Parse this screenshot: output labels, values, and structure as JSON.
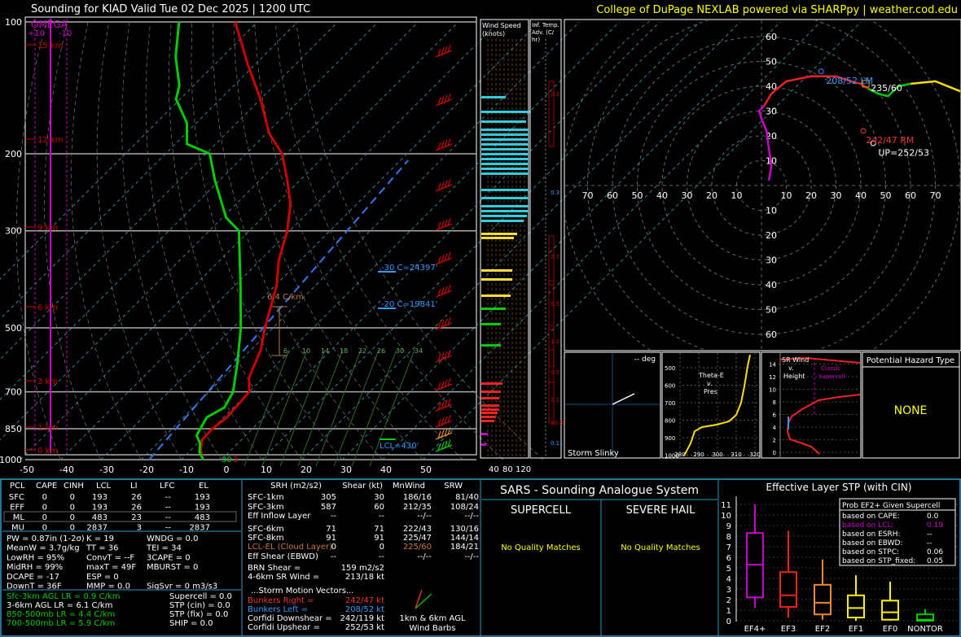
{
  "title": "Sounding for KIAD Valid  Tue 02 Dec 2025 | 1200 UTC",
  "credit": "College of DuPage NEXLAB powered via SHARPpy | weather.cod.edu",
  "colors": {
    "bg": "#000000",
    "grid": "#ffffff",
    "temp": "#cc0000",
    "dew": "#00cc00",
    "omega": "#cc00cc",
    "panel_border": "#3399cc",
    "credit": "#ffff00"
  },
  "skewt": {
    "omega_label": "OMEGA",
    "omega_ticks": [
      "+10",
      "-10"
    ],
    "pressure_labels": [
      "100",
      "200",
      "300",
      "500",
      "700",
      "850",
      "1000"
    ],
    "temp_ticks": [
      "-50",
      "-40",
      "-30",
      "-20",
      "-10",
      "0",
      "10",
      "20",
      "30",
      "40",
      "50"
    ],
    "height_labels": [
      "15 km",
      "12 km",
      "9 km",
      "6 km",
      "3 km",
      "1 km",
      "0 km"
    ],
    "lapse_label": "6.4 C/km",
    "level_labels": [
      "-30 C=24397'",
      "-20 C=19841'",
      "LCL=430'"
    ],
    "mixing_ratio_labels": [
      "6",
      "10",
      "14",
      "18",
      "22",
      "26",
      "30",
      "34"
    ],
    "sfc_temps": [
      "30",
      "3"
    ]
  },
  "wind_speed": {
    "title": "Wind Speed (knots)",
    "ticks": [
      "40",
      "80",
      "120"
    ]
  },
  "inf_temp": {
    "title": "Inf. Temp. Adv. (C/hr)",
    "values": [
      "2.2",
      "0.3",
      "2.7",
      "0.5",
      "1.2",
      "0.5",
      "2.1",
      "10.8",
      "0.11"
    ]
  },
  "hodograph": {
    "ring_labels": [
      "10",
      "20",
      "30",
      "40",
      "50",
      "60",
      "70"
    ],
    "left_motion_label": "208/52 LM",
    "right_motion_label": "242/47 RM",
    "upshear_label": "UP=252/53",
    "mean_wind_label": "235/60"
  },
  "storm_slinky": {
    "title": "Storm Slinky",
    "deg_label": "-- deg"
  },
  "theta_e": {
    "title": "Theta-E v. Pres",
    "y_ticks": [
      "500",
      "600",
      "700",
      "800",
      "900",
      "1000"
    ],
    "x_ticks": [
      "280",
      "290",
      "300",
      "310",
      "320"
    ]
  },
  "sr_wind": {
    "title": "SR Wind v. Height",
    "classic_label": "Classic Supercell",
    "y_ticks": [
      "0",
      "2",
      "4",
      "6",
      "8",
      "10",
      "12",
      "14"
    ]
  },
  "hazard": {
    "title": "Potential Hazard Type",
    "value": "NONE"
  },
  "parcels": {
    "headers": [
      "PCL",
      "CAPE",
      "CINH",
      "LCL",
      "LI",
      "LFC",
      "EL"
    ],
    "rows": [
      [
        "SFC",
        "0",
        "0",
        "193",
        "26",
        "--",
        "193"
      ],
      [
        "EFF",
        "0",
        "0",
        "193",
        "26",
        "--",
        "193"
      ],
      [
        "ML",
        "0",
        "0",
        "483",
        "23",
        "--",
        "483"
      ],
      [
        "MU",
        "0",
        "0",
        "2837",
        "3",
        "--",
        "2837"
      ]
    ]
  },
  "indices": [
    [
      "PW = 0.87in (1-2σ)",
      "K = 19",
      "WNDG = 0.0"
    ],
    [
      "MeanW = 3.7g/kg",
      "TT = 36",
      "TEI = 34"
    ],
    [
      "LowRH = 95%",
      "ConvT = --F",
      "3CAPE = 0"
    ],
    [
      "MidRH = 99%",
      "maxT = 49F",
      "MBURST = 0"
    ],
    [
      "DCAPE = -17",
      "ESP = 0",
      ""
    ],
    [
      "DownT = 36F",
      "MMP = 0.0",
      "SigSvr = 0 m3/s3"
    ]
  ],
  "lapse_rates": [
    "Sfc-3km AGL LR = 0.9 C/km",
    "3-6km AGL LR = 6.1 C/km",
    "850-500mb LR = 4.4 C/km",
    "700-500mb LR = 5.9 C/km"
  ],
  "composites": [
    "Supercell = 0.0",
    "STP (cin) = 0.0",
    "STP (fix) = 0.0",
    "SHIP = 0.0"
  ],
  "kinematics": {
    "headers": [
      "SRH (m2/s2)",
      "Shear (kt)",
      "MnWind",
      "SRW"
    ],
    "rows": [
      [
        "SFC-1km",
        "305",
        "30",
        "186/16",
        "81/40"
      ],
      [
        "SFC-3km",
        "587",
        "60",
        "212/35",
        "108/24"
      ],
      [
        "Eff Inflow Layer",
        "--",
        "--",
        "--/--",
        "--/--"
      ],
      [
        "SFC-6km",
        "71",
        "71",
        "222/43",
        "130/16"
      ],
      [
        "SFC-8km",
        "91",
        "91",
        "225/47",
        "144/14"
      ],
      [
        "LCL-EL (Cloud Layer)",
        "0",
        "0",
        "225/60",
        "184/21"
      ],
      [
        "Eff Shear (EBWD)",
        "--",
        "--",
        "--/--",
        "--/--"
      ]
    ],
    "brn_shear": [
      "BRN Shear =",
      "159 m2/s2"
    ],
    "sr_wind_46": [
      "4-6km SR Wind =",
      "213/18 kt"
    ],
    "storm_motion_title": "...Storm Motion Vectors...",
    "motions": [
      [
        "Bunkers Right =",
        "242/47 kt"
      ],
      [
        "Bunkers Left =",
        "208/52 kt"
      ],
      [
        "Corfidi Downshear =",
        "242/119 kt"
      ],
      [
        "Corfidi Upshear =",
        "252/53 kt"
      ]
    ],
    "barb_label_1": "1km & 6km AGL",
    "barb_label_2": "Wind Barbs"
  },
  "sars": {
    "title": "SARS - Sounding Analogue System",
    "supercell": "SUPERCELL",
    "hail": "SEVERE HAIL",
    "no_match": "No Quality Matches"
  },
  "stp": {
    "title": "Effective Layer STP (with CIN)",
    "prob_title": "Prob EF2+ Given Supercell",
    "probs": [
      [
        "based on CAPE:",
        "0.0"
      ],
      [
        "based on LCL:",
        "0.19"
      ],
      [
        "based on ESRH:",
        "--"
      ],
      [
        "based on EBWD:",
        "--"
      ],
      [
        "based on STPC:",
        "0.06"
      ],
      [
        "based on STP_fixed:",
        "0.05"
      ]
    ],
    "y_ticks": [
      "0",
      "1",
      "2",
      "3",
      "4",
      "5",
      "6",
      "7",
      "8",
      "9",
      "10",
      "11"
    ],
    "categories": [
      "EF4+",
      "EF3",
      "EF2",
      "EF1",
      "EF0",
      "NONTOR"
    ]
  },
  "chart_data": {
    "type": "line",
    "title": "Sounding for KIAD Valid  Tue 02 Dec 2025 | 1200 UTC",
    "xlabel": "",
    "ylabel": "",
    "xlim": [
      -50,
      50
    ],
    "ylim": [
      1000,
      100
    ],
    "series": [
      {
        "x": [
          -50,
          -41,
          -33,
          -26,
          -20,
          -15,
          -11,
          -8,
          -6,
          -3,
          0,
          2,
          3,
          5,
          4,
          3,
          1,
          0,
          1,
          3
        ],
        "y": [
          100,
          125,
          150,
          180,
          200,
          230,
          260,
          300,
          350,
          400,
          500,
          560,
          650,
          700,
          750,
          800,
          850,
          900,
          950,
          1000
        ]
      },
      {
        "x": [
          -64,
          -60,
          -55,
          -54,
          -48,
          -45,
          -38,
          -33,
          -25,
          -20,
          -12,
          -6,
          -2,
          1,
          1,
          -2,
          -2,
          -2,
          0,
          1,
          3
        ],
        "y": [
          100,
          120,
          140,
          150,
          170,
          190,
          200,
          230,
          280,
          300,
          400,
          500,
          600,
          700,
          760,
          800,
          850,
          880,
          920,
          960,
          1000
        ]
      }
    ],
    "stp_boxes": [
      {
        "category": "EF4+",
        "whisker_low": 1.2,
        "q1": 2.2,
        "median": 5.3,
        "q3": 8.3,
        "whisker_high": 11.0
      },
      {
        "category": "EF3",
        "whisker_low": 0.3,
        "q1": 1.3,
        "median": 2.4,
        "q3": 4.6,
        "whisker_high": 8.5
      },
      {
        "category": "EF2",
        "whisker_low": 0.1,
        "q1": 0.6,
        "median": 1.7,
        "q3": 3.4,
        "whisker_high": 5.8
      },
      {
        "category": "EF1",
        "whisker_low": 0.0,
        "q1": 0.3,
        "median": 1.2,
        "q3": 2.4,
        "whisker_high": 4.3
      },
      {
        "category": "EF0",
        "whisker_low": 0.0,
        "q1": 0.1,
        "median": 0.8,
        "q3": 1.9,
        "whisker_high": 3.7
      },
      {
        "category": "NONTOR",
        "whisker_low": 0.0,
        "q1": 0.0,
        "median": 0.1,
        "q3": 0.6,
        "whisker_high": 1.1
      }
    ]
  }
}
